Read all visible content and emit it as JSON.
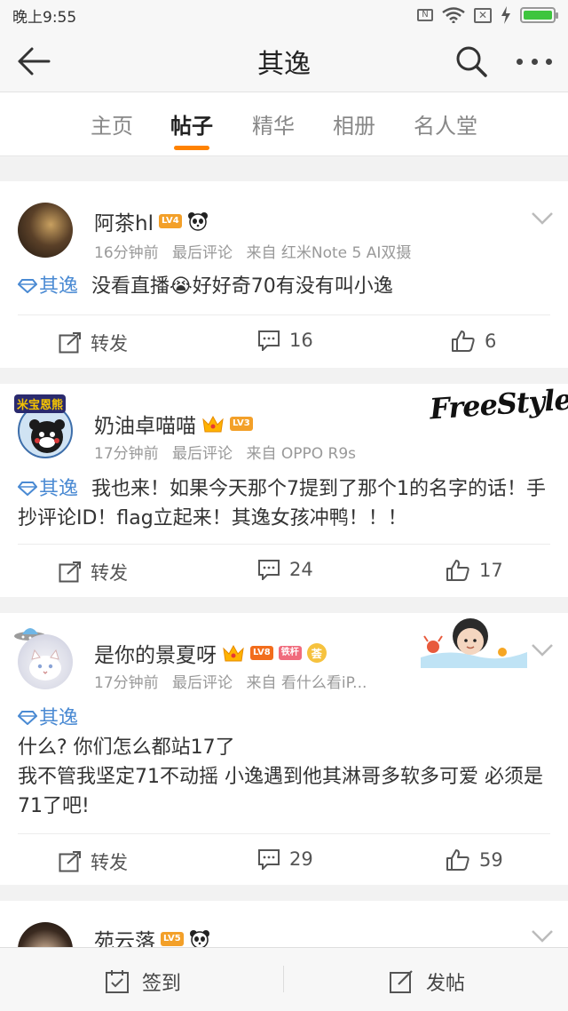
{
  "status_bar": {
    "time": "晚上9:55",
    "sim_label": "N",
    "battery_level": 1.0
  },
  "header": {
    "title": "其逸"
  },
  "tabs": [
    {
      "label": "主页"
    },
    {
      "label": "帖子",
      "active": true
    },
    {
      "label": "精华"
    },
    {
      "label": "相册"
    },
    {
      "label": "名人堂"
    }
  ],
  "colors": {
    "accent": "#ff8200",
    "topic_blue": "#4a8ad3",
    "level_orange": "#f3a029"
  },
  "posts": [
    {
      "author": "阿茶hl",
      "level": "LV4",
      "time": "16分钟前",
      "last_comment": "最后评论",
      "source": "来自 红米Note 5 AI双摄",
      "topic": "其逸",
      "content": "没看直播😭好好奇70有没有叫小逸",
      "actions": {
        "repost": "转发",
        "comments": "16",
        "likes": "6"
      }
    },
    {
      "author": "奶油卓喵喵",
      "level": "LV3",
      "time": "17分钟前",
      "last_comment": "最后评论",
      "source": "来自 OPPO R9s",
      "topic": "其逸",
      "content": "我也来！如果今天那个7提到了那个1的名字的话！手抄评论ID！flag立起来！其逸女孩冲鸭！！！",
      "decoration_text": "FreeStyle",
      "avatar_caption": "米宝恩熊",
      "actions": {
        "repost": "转发",
        "comments": "24",
        "likes": "17"
      }
    },
    {
      "author": "是你的景夏呀",
      "level": "LV8",
      "extra_badge": "铁杆",
      "extra_badge_2": "荟",
      "time": "17分钟前",
      "last_comment": "最后评论",
      "source": "来自 看什么看iP...",
      "topic": "其逸",
      "content_line1": "什么? 你们怎么都站17了",
      "content_line2": "我不管我坚定71不动摇 小逸遇到他其淋哥多软多可爱 必须是71了吧!",
      "actions": {
        "repost": "转发",
        "comments": "29",
        "likes": "59"
      }
    },
    {
      "author": "苑云落",
      "level": "LV5"
    }
  ],
  "bottom_bar": {
    "checkin": "签到",
    "post": "发帖"
  }
}
